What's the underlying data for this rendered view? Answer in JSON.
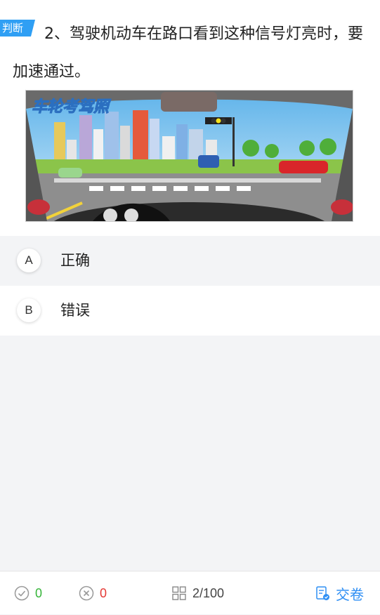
{
  "question": {
    "badge": "判断",
    "text": "2、驾驶机动车在路口看到这种信号灯亮时，要加速通过。",
    "image_watermark": "车轮考驾照"
  },
  "options": [
    {
      "letter": "A",
      "text": "正确"
    },
    {
      "letter": "B",
      "text": "错误"
    }
  ],
  "footer": {
    "correct_count": "0",
    "wrong_count": "0",
    "progress": "2/100",
    "submit_label": "交卷"
  },
  "colors": {
    "accent": "#2f8ff4",
    "correct": "#36b53a",
    "wrong": "#e53935"
  }
}
